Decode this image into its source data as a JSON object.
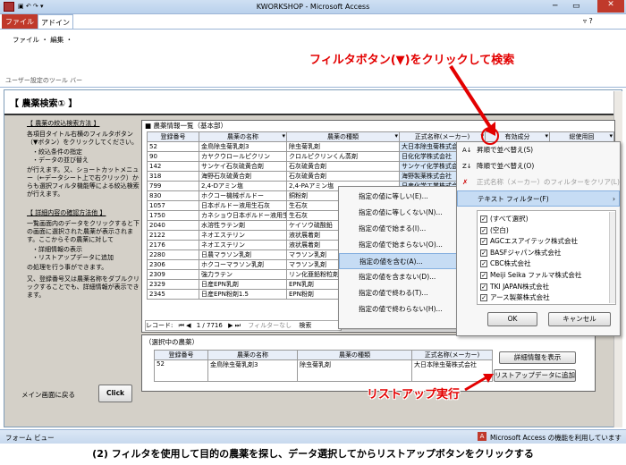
{
  "window": {
    "title": "KWORKSHOP - Microsoft Access"
  },
  "ribbon": {
    "tabs": [
      "ファイル",
      "アドイン"
    ],
    "menu": "ファイル ・ 編集 ・",
    "toolbar_label": "ユーザー設定のツール バー"
  },
  "form": {
    "title": "【 農薬検索① 】",
    "sidebar": {
      "section1_title": "【 農薬の絞込検索方法 】",
      "section1_text": "各項目タイトル右横のフィルタボタン（▼ボタン）をクリックしてください。",
      "section1_bullets": [
        "・絞込条件の指定",
        "・データの並び替え"
      ],
      "section1_text2": "が行えます。又、ショートカットメニュー（←データシート上で右クリック）からも選択フィルタ機能等による絞込検索が行えます。",
      "section2_title": "【 詳細内容の確認方法他 】",
      "section2_text": "一覧画面内のデータをクリックすると下の画面に選択された農薬が表示されます。ここからその農薬に対して",
      "section2_bullets": [
        "・詳細情報の表示",
        "・リストアップデータに追加"
      ],
      "section2_text2": "の処理を行う事ができます。",
      "section2_text3": "又、登録番号又は農薬名称をダブルクリックすることでも、詳細情報が表示できます。",
      "back_label": "メイン画面に戻る",
      "click_button": "Click"
    },
    "list_title": "■ 農薬情報一覧（基本部）",
    "columns": [
      "登録番号",
      "農薬の名称",
      "農薬の種類",
      "正式名称(メーカー)",
      "有効成分",
      "総使用回"
    ],
    "rows": [
      [
        "52",
        "金鳥除虫菊乳剤3",
        "除虫菊乳剤",
        "大日本除虫菊株式会社"
      ],
      [
        "90",
        "カヤクウロールピクリン",
        "クロルピクリンくん蒸剤",
        "日化化学株式会社"
      ],
      [
        "142",
        "サンケイ石灰硫黄合剤",
        "石灰硫黄合剤",
        "サンケイ化学株式会社"
      ],
      [
        "318",
        "海野石灰硫黄合剤",
        "石灰硫黄合剤",
        "海野製薬株式会社"
      ],
      [
        "799",
        "2,4-Dアミン塩",
        "2,4-PAアミン塩",
        "日産化学工業株式会社"
      ],
      [
        "830",
        "ホクコー機械ボルドー",
        "銅粉剤",
        "北興化学工業株式会社"
      ],
      [
        "1057",
        "日本ボルドー液用生石灰",
        "生石灰",
        "日本化薬株式会社"
      ],
      [
        "1750",
        "カネショウ日本ボルドー液用生石灰",
        "生石灰",
        "カネショウ株式会社"
      ],
      [
        "2040",
        "水溶性ラテン剤",
        "ケイソウ硫酸鉛",
        "日本農薬株式会社"
      ],
      [
        "2122",
        "ネオエステリン",
        "液状展着剤",
        "クミアイ化学工業株式会社"
      ],
      [
        "2176",
        "ネオエステリン",
        "液状展着剤",
        "住友化学株式会社"
      ],
      [
        "2280",
        "日農マラソン乳剤",
        "マラソン乳剤",
        "日本農薬株式会社"
      ],
      [
        "2306",
        "ホクコーマラソン乳剤",
        "マラソン乳剤",
        "北興化学工業株式会社"
      ],
      [
        "2309",
        "強力ラテン",
        "リン化亜鉛粉粒剤",
        "大塚化学株式会社"
      ],
      [
        "2329",
        "日産EPN乳剤",
        "EPN乳剤",
        "日産化学工業株式会社"
      ],
      [
        "2345",
        "日産EPN粉剤1.5",
        "EPN粉剤",
        "日本化学工業株式会社"
      ]
    ],
    "nav": {
      "record_label": "レコード:",
      "record_pos": "1 / 7716",
      "filter": "フィルターなし",
      "search": "検索"
    },
    "selected_title": "（選択中の農薬）",
    "selected_columns": [
      "登録番号",
      "農薬の名称",
      "農薬の種類",
      "正式名称(メーカー)"
    ],
    "selected_row": [
      "52",
      "金鳥除虫菊乳剤3",
      "除虫菊乳剤",
      "大日本除虫菊株式会社"
    ],
    "detail_button": "詳細情報を表示",
    "add_button": "リストアップデータに追加"
  },
  "filter_menu": {
    "items": [
      "昇順で並べ替え(S)",
      "降順で並べ替え(O)",
      "正式名称（メーカー）のフィルターをクリア(L)",
      "テキスト フィルター(F)"
    ],
    "checks": [
      "(すべて選択)",
      "(空白)",
      "AGCエスアイテック株式会社",
      "BASFジャパン株式会社",
      "CBC株式会社",
      "Meiji Seika ファルマ株式会社",
      "TKI JAPAN株式会社",
      "アース製薬株式会社"
    ],
    "ok": "OK",
    "cancel": "キャンセル"
  },
  "text_filter_menu": {
    "items": [
      "指定の値に等しい(E)...",
      "指定の値に等しくない(N)...",
      "指定の値で始まる(I)...",
      "指定の値で始まらない(O)...",
      "指定の値を含む(A)...",
      "指定の値を含まない(D)...",
      "指定の値で終わる(T)...",
      "指定の値で終わらない(H)..."
    ]
  },
  "callouts": {
    "top": "フィルタボタン(▼)をクリックして検索",
    "bottom": "リストアップ実行"
  },
  "status": {
    "left": "フォーム ビュー",
    "right": "Microsoft Access の機能を利用しています"
  },
  "caption": "(2) フィルタを使用して目的の農薬を探し、データ選択してからリストアップボタンをクリックする"
}
